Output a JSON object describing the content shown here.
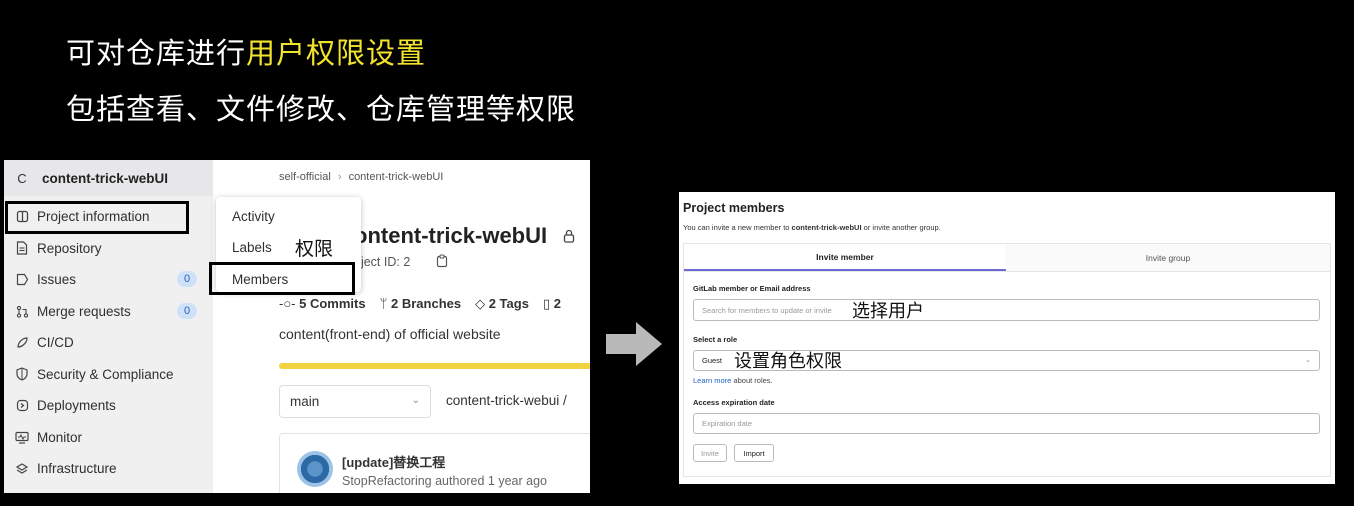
{
  "headline": {
    "line1_prefix": "可对仓库进行",
    "line1_highlight": "用户权限设置",
    "line2": "包括查看、文件修改、仓库管理等权限"
  },
  "left_panel": {
    "project_avatar_letter": "C",
    "project_name": "content-trick-webUI",
    "nav": [
      {
        "label": "Project information",
        "icon": "info-icon"
      },
      {
        "label": "Repository",
        "icon": "file-icon"
      },
      {
        "label": "Issues",
        "icon": "issues-icon",
        "count": "0"
      },
      {
        "label": "Merge requests",
        "icon": "merge-icon",
        "count": "0"
      },
      {
        "label": "CI/CD",
        "icon": "rocket-icon"
      },
      {
        "label": "Security & Compliance",
        "icon": "shield-icon"
      },
      {
        "label": "Deployments",
        "icon": "deploy-icon"
      },
      {
        "label": "Monitor",
        "icon": "monitor-icon"
      },
      {
        "label": "Infrastructure",
        "icon": "cloud-icon"
      }
    ],
    "breadcrumb": {
      "group": "self-official",
      "separator": "›",
      "project": "content-trick-webUI"
    },
    "flyout": {
      "items": [
        "Activity",
        "Labels",
        "Members"
      ]
    },
    "annotation_labels": "权限",
    "project_title": "ontent-trick-webUI",
    "project_id": "oject ID: 2",
    "stats": {
      "commits": "5 Commits",
      "branches": "2 Branches",
      "tags": "2 Tags",
      "more": "2"
    },
    "description": "content(front-end) of official website",
    "branch": "main",
    "path": "content-trick-webui  /",
    "commit": {
      "title": "[update]替换工程",
      "subtitle": "StopRefactoring authored 1 year ago"
    }
  },
  "right_panel": {
    "title": "Project members",
    "subtitle_prefix": "You can invite a new member to ",
    "subtitle_project": "content-trick-webUI",
    "subtitle_suffix": " or invite another group.",
    "tabs": [
      "Invite member",
      "Invite group"
    ],
    "member_label": "GitLab member or Email address",
    "member_placeholder": "Search for members to update or invite",
    "annotation_select_user": "选择用户",
    "role_label": "Select a role",
    "role_value": "Guest",
    "annotation_set_role": "设置角色权限",
    "learn_more_link": "Learn more",
    "learn_more_suffix": " about roles.",
    "expiration_label": "Access expiration date",
    "expiration_placeholder": "Expiration date",
    "invite_button": "Invite",
    "import_button": "Import"
  },
  "colors": {
    "highlight_yellow": "#f2e32e",
    "progress_yellow": "#f0d33e",
    "badge_blue": "#1f63c6",
    "tab_underline": "#6b6bd6"
  }
}
